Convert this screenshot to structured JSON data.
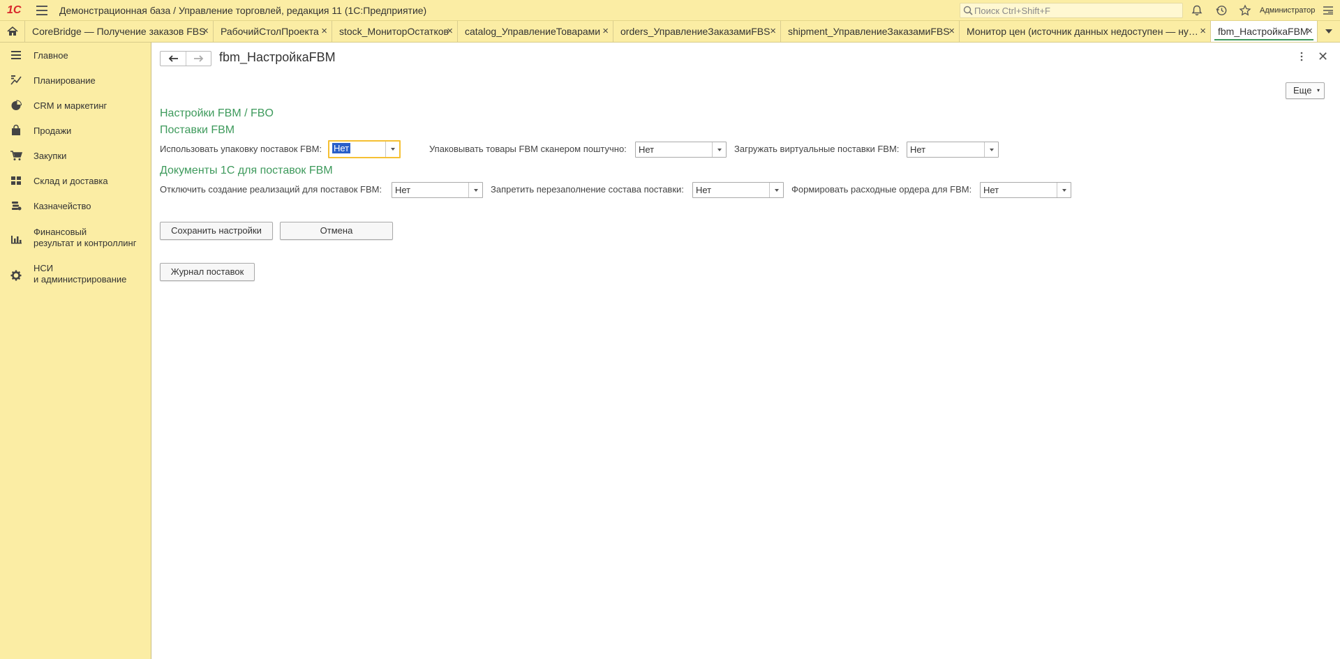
{
  "app": {
    "logo": "1С",
    "title": "Демонстрационная база / Управление торговлей, редакция 11  (1С:Предприятие)",
    "search_placeholder": "Поиск Ctrl+Shift+F",
    "user": "Администратор"
  },
  "tabs": [
    {
      "label": "CoreBridge — Получение заказов FBS",
      "close": "×"
    },
    {
      "label": "РабочийСтолПроекта",
      "close": "×"
    },
    {
      "label": "stock_МониторОстатков",
      "close": "×"
    },
    {
      "label": "catalog_УправлениеТоварами",
      "close": "×"
    },
    {
      "label": "orders_УправлениеЗаказамиFBS",
      "close": "×"
    },
    {
      "label": "shipment_УправлениеЗаказамиFBS",
      "close": "×"
    },
    {
      "label": "Монитор цен (источник данных недоступен — ну…",
      "close": "×"
    },
    {
      "label": "fbm_НастройкаFBM",
      "close": "×",
      "active": true
    }
  ],
  "sidebar": {
    "items": [
      {
        "label": "Главное",
        "icon": "menu-lines-icon"
      },
      {
        "label": "Планирование",
        "icon": "planning-icon"
      },
      {
        "label": "CRM и маркетинг",
        "icon": "pie-chart-icon"
      },
      {
        "label": "Продажи",
        "icon": "bag-icon"
      },
      {
        "label": "Закупки",
        "icon": "cart-icon"
      },
      {
        "label": "Склад и доставка",
        "icon": "warehouse-grid-icon"
      },
      {
        "label": "Казначейство",
        "icon": "coins-icon"
      },
      {
        "label": "Финансовый\nрезультат и контроллинг",
        "icon": "bar-chart-icon"
      },
      {
        "label": "НСИ\nи администрирование",
        "icon": "gear-icon"
      }
    ]
  },
  "page": {
    "title": "fbm_НастройкаFBM",
    "more_button": "Еще",
    "more_caret": "▾",
    "section_main": "Настройки FBM / FBO",
    "section_shipments": "Поставки FBM",
    "section_docs": "Документы 1С для поставок FBM",
    "fields_row1": [
      {
        "label": "Использовать упаковку поставок FBM:",
        "value": "Нет"
      },
      {
        "label": "Упаковывать товары FBM сканером поштучно:",
        "value": "Нет"
      },
      {
        "label": "Загружать виртуальные поставки FBM:",
        "value": "Нет"
      }
    ],
    "fields_row2": [
      {
        "label": "Отключить создание реализаций для поставок FBM:",
        "value": "Нет"
      },
      {
        "label": "Запретить перезаполнение состава поставки:",
        "value": "Нет"
      },
      {
        "label": "Формировать расходные ордера для FBM:",
        "value": "Нет"
      }
    ],
    "save_button": "Сохранить настройки",
    "cancel_button": "Отмена",
    "journal_button": "Журнал поставок"
  },
  "colors": {
    "panel_bg": "#fbeda4",
    "section_green": "#3e9a5c",
    "focus_border": "#f5c033",
    "selection_blue": "#2a5fc9"
  }
}
